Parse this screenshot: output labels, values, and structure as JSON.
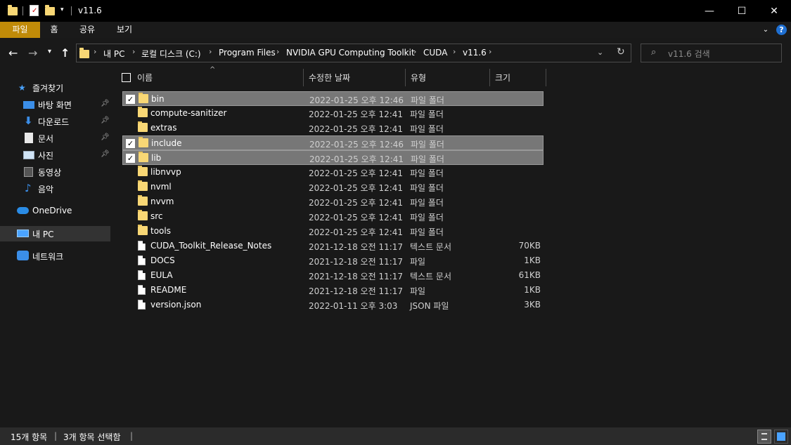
{
  "window": {
    "title": "v11.6",
    "minimize": "—",
    "maximize": "☐",
    "close": "✕"
  },
  "ribbon": {
    "tabs": [
      "파일",
      "홈",
      "공유",
      "보기"
    ],
    "help": "?"
  },
  "address": {
    "crumbs": [
      "내 PC",
      "로컬 디스크 (C:)",
      "Program Files",
      "NVIDIA GPU Computing Toolkit",
      "CUDA",
      "v11.6"
    ],
    "search_placeholder": "v11.6 검색"
  },
  "nav": {
    "items": [
      {
        "label": "즐겨찾기",
        "icon": "star-icon",
        "pinned": false
      },
      {
        "label": "바탕 화면",
        "icon": "desktop-icon",
        "pinned": true
      },
      {
        "label": "다운로드",
        "icon": "download-icon",
        "pinned": true
      },
      {
        "label": "문서",
        "icon": "document-icon",
        "pinned": true
      },
      {
        "label": "사진",
        "icon": "picture-icon",
        "pinned": true
      },
      {
        "label": "동영상",
        "icon": "video-icon",
        "pinned": false
      },
      {
        "label": "음악",
        "icon": "music-icon",
        "pinned": false
      },
      {
        "label": "OneDrive",
        "icon": "cloud-icon",
        "pinned": false
      },
      {
        "label": "내 PC",
        "icon": "computer-icon",
        "pinned": false
      },
      {
        "label": "네트워크",
        "icon": "network-icon",
        "pinned": false
      }
    ]
  },
  "columns": {
    "name": "이름",
    "date": "수정한 날짜",
    "type": "유형",
    "size": "크기"
  },
  "files": [
    {
      "name": "bin",
      "date": "2022-01-25 오후 12:46",
      "type": "파일 폴더",
      "size": "",
      "kind": "folder",
      "selected": true
    },
    {
      "name": "compute-sanitizer",
      "date": "2022-01-25 오후 12:41",
      "type": "파일 폴더",
      "size": "",
      "kind": "folder",
      "selected": false
    },
    {
      "name": "extras",
      "date": "2022-01-25 오후 12:41",
      "type": "파일 폴더",
      "size": "",
      "kind": "folder",
      "selected": false
    },
    {
      "name": "include",
      "date": "2022-01-25 오후 12:46",
      "type": "파일 폴더",
      "size": "",
      "kind": "folder",
      "selected": true
    },
    {
      "name": "lib",
      "date": "2022-01-25 오후 12:41",
      "type": "파일 폴더",
      "size": "",
      "kind": "folder",
      "selected": true
    },
    {
      "name": "libnvvp",
      "date": "2022-01-25 오후 12:41",
      "type": "파일 폴더",
      "size": "",
      "kind": "folder",
      "selected": false
    },
    {
      "name": "nvml",
      "date": "2022-01-25 오후 12:41",
      "type": "파일 폴더",
      "size": "",
      "kind": "folder",
      "selected": false
    },
    {
      "name": "nvvm",
      "date": "2022-01-25 오후 12:41",
      "type": "파일 폴더",
      "size": "",
      "kind": "folder",
      "selected": false
    },
    {
      "name": "src",
      "date": "2022-01-25 오후 12:41",
      "type": "파일 폴더",
      "size": "",
      "kind": "folder",
      "selected": false
    },
    {
      "name": "tools",
      "date": "2022-01-25 오후 12:41",
      "type": "파일 폴더",
      "size": "",
      "kind": "folder",
      "selected": false
    },
    {
      "name": "CUDA_Toolkit_Release_Notes",
      "date": "2021-12-18 오전 11:17",
      "type": "텍스트 문서",
      "size": "70KB",
      "kind": "file",
      "selected": false
    },
    {
      "name": "DOCS",
      "date": "2021-12-18 오전 11:17",
      "type": "파일",
      "size": "1KB",
      "kind": "file",
      "selected": false
    },
    {
      "name": "EULA",
      "date": "2021-12-18 오전 11:17",
      "type": "텍스트 문서",
      "size": "61KB",
      "kind": "file",
      "selected": false
    },
    {
      "name": "README",
      "date": "2021-12-18 오전 11:17",
      "type": "파일",
      "size": "1KB",
      "kind": "file",
      "selected": false
    },
    {
      "name": "version.json",
      "date": "2022-01-11 오후 3:03",
      "type": "JSON 파일",
      "size": "3KB",
      "kind": "file",
      "selected": false
    }
  ],
  "status": {
    "count": "15개 항목",
    "selected": "3개 항목 선택함"
  },
  "colors": {
    "accent": "#c18b08",
    "folder": "#f8d775",
    "selection": "#777777"
  }
}
